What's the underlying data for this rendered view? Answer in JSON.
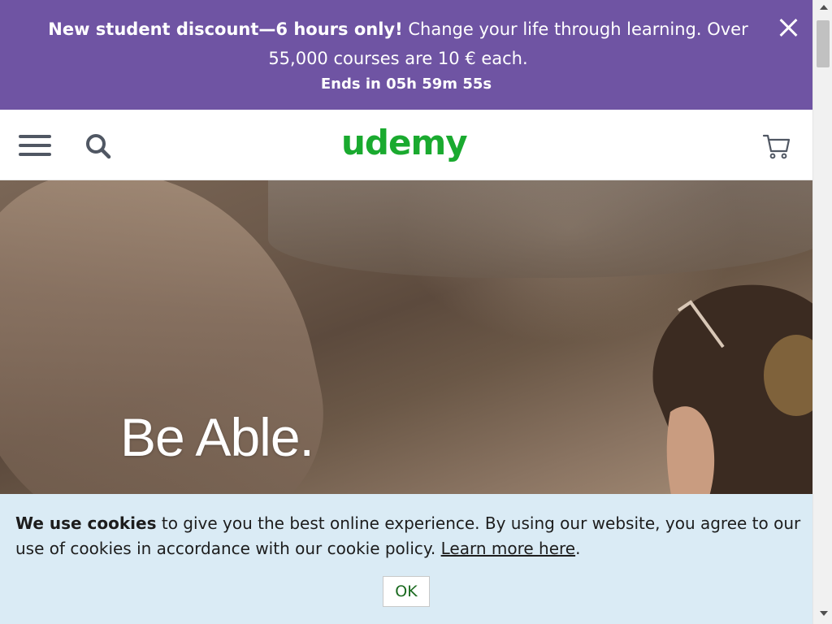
{
  "promo": {
    "headline": "New student discount—6 hours only!",
    "message": " Change your life through learning. Over 55,000 courses are 10 € each.",
    "countdown": "Ends in 05h 59m 55s",
    "background_color": "#6f54a3"
  },
  "header": {
    "logo": "udemy",
    "logo_color": "#1aaa2f",
    "icons": [
      "menu-icon",
      "search-icon",
      "cart-icon"
    ]
  },
  "hero": {
    "title": "Be Able."
  },
  "cookie": {
    "bold": "We use cookies",
    "text": " to give you the best online experience. By using our website, you agree to our use of cookies in accordance with our cookie policy. ",
    "link": "Learn more here",
    "period": ".",
    "ok_label": "OK",
    "background_color": "#daebf5"
  }
}
